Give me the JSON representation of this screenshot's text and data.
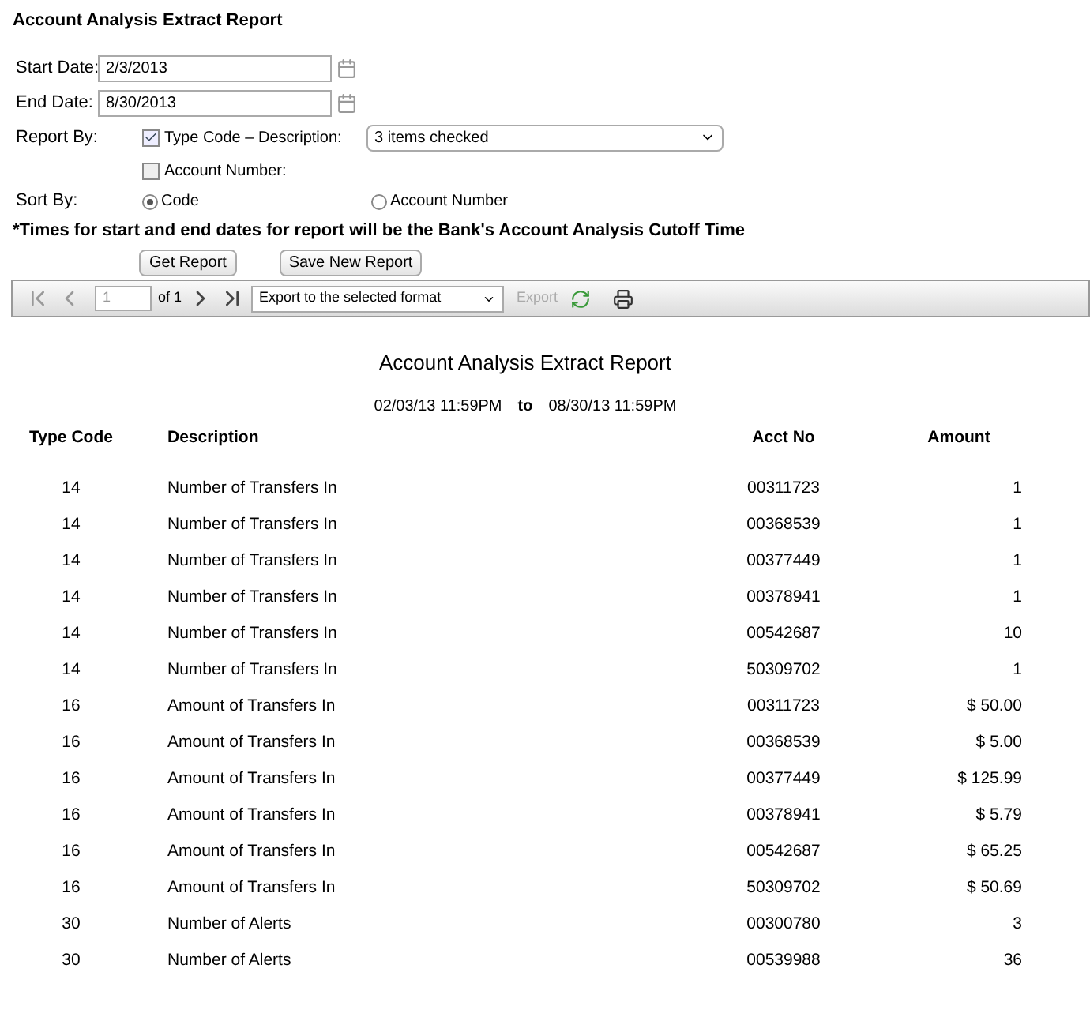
{
  "title": "Account Analysis Extract Report",
  "form": {
    "start_date": {
      "label": "Start Date:",
      "value": "2/3/2013"
    },
    "end_date": {
      "label": "End Date:",
      "value": "8/30/2013"
    },
    "report_by": {
      "label": "Report By:",
      "options": [
        {
          "label": "Type Code – Description:",
          "checked": true,
          "select_value": "3 items checked"
        },
        {
          "label": "Account Number:",
          "checked": false
        }
      ]
    },
    "sort_by": {
      "label": "Sort By:",
      "options": [
        {
          "label": "Code",
          "selected": true
        },
        {
          "label": "Account Number",
          "selected": false
        }
      ]
    },
    "note": "*Times for start and end dates for report will be the Bank's Account Analysis Cutoff Time",
    "buttons": [
      "Get Report",
      "Save New Report"
    ]
  },
  "toolbar": {
    "nav": [
      {
        "kind": "first",
        "disabled": true
      },
      {
        "kind": "prev",
        "disabled": true
      },
      {
        "kind": "next",
        "disabled": false
      },
      {
        "kind": "last",
        "disabled": false
      }
    ],
    "page": "1",
    "of": "of 1",
    "format": "Export to the selected format",
    "export": {
      "label": "Export",
      "disabled": true
    }
  },
  "report": {
    "title": "Account Analysis Extract Report",
    "from": "02/03/13 11:59PM",
    "to_label": "to",
    "to": "08/30/13 11:59PM",
    "columns": [
      "Type Code",
      "Description",
      "Acct No",
      "Amount"
    ],
    "rows": [
      [
        "14",
        "Number of Transfers In",
        "00311723",
        "1"
      ],
      [
        "14",
        "Number of Transfers In",
        "00368539",
        "1"
      ],
      [
        "14",
        "Number of Transfers In",
        "00377449",
        "1"
      ],
      [
        "14",
        "Number of Transfers In",
        "00378941",
        "1"
      ],
      [
        "14",
        "Number of Transfers In",
        "00542687",
        "10"
      ],
      [
        "14",
        "Number of Transfers In",
        "50309702",
        "1"
      ],
      [
        "16",
        "Amount of Transfers In",
        "00311723",
        "$ 50.00"
      ],
      [
        "16",
        "Amount of Transfers In",
        "00368539",
        "$ 5.00"
      ],
      [
        "16",
        "Amount of Transfers In",
        "00377449",
        "$ 125.99"
      ],
      [
        "16",
        "Amount of Transfers In",
        "00378941",
        "$ 5.79"
      ],
      [
        "16",
        "Amount of Transfers In",
        "00542687",
        "$ 65.25"
      ],
      [
        "16",
        "Amount of Transfers In",
        "50309702",
        "$ 50.69"
      ],
      [
        "30",
        "Number of Alerts",
        "00300780",
        "3"
      ],
      [
        "30",
        "Number of Alerts",
        "00539988",
        "36"
      ]
    ]
  }
}
